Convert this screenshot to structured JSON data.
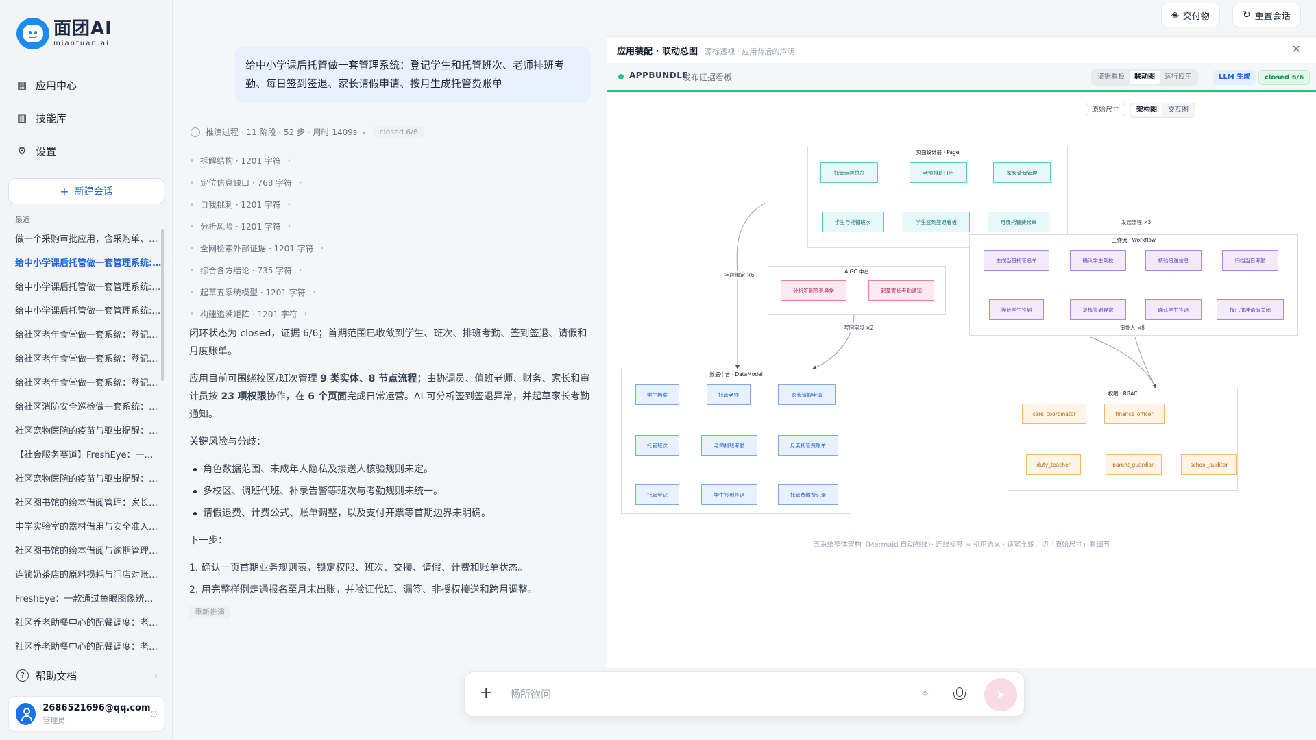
{
  "app": {
    "logo_main": "面团AI",
    "logo_sub": "miantuan.ai"
  },
  "nav": {
    "apps": "应用中心",
    "skills": "技能库",
    "settings": "设置"
  },
  "new_chat": "新建会话",
  "recent_label": "最近",
  "history": [
    "做一个采购审批应用，含采购单、经…",
    "给中小学课后托管做一套管理系统: …",
    "给中小学课后托管做一套管理系统: …",
    "给中小学课后托管做一套管理系统: …",
    "给社区老年食堂做一套系统：登记就…",
    "给社区老年食堂做一套系统：登记就…",
    "给社区老年食堂做一套系统：登记就…",
    "给社区消防安全巡检做一套系统：登…",
    "社区宠物医院的疫苗与驱虫提醒：建…",
    "【社会服务赛道】FreshEye：一款通…",
    "社区宠物医院的疫苗与驱虫提醒：建…",
    "社区图书馆的绘本借阅管理：家长预…",
    "中学实验室的器材借用与安全准入：…",
    "社区图书馆的绘本借阅与逾期管理：…",
    "连锁奶茶店的原料损耗与门店对账：…",
    "FreshEye：一款通过鱼眼图像辨别水…",
    "社区养老助餐中心的配餐调度：老人…",
    "社区养老助餐中心的配餐调度：老人…"
  ],
  "help": "帮助文档",
  "user": {
    "email": "2686521696@qq.com",
    "role": "管理员"
  },
  "top_buttons": {
    "deliverables": "交付物",
    "reset": "重置会话"
  },
  "chat": {
    "prompt": "给中小学课后托管做一套管理系统：登记学生和托管班次、老师排班考勤、每日签到签退、家长请假申请、按月生成托管费账单",
    "reason_summary": "推演过程 · 11 阶段 · 52 步 · 用时 1409s",
    "reason_badge": "closed 6/6",
    "steps": [
      "拆解结构 · 1201 字符",
      "定位信息缺口 · 768 字符",
      "自我挑刺 · 1201 字符",
      "分析风险 · 1201 字符",
      "全网检索外部证据 · 1201 字符",
      "综合各方结论 · 735 字符",
      "起草五系统模型 · 1201 字符",
      "构建追溯矩阵 · 1201 字符"
    ],
    "answer_p1": "闭环状态为 closed，证据 6/6；首期范围已收敛到学生、班次、排班考勤、签到签退、请假和月度账单。",
    "answer_p2a": "应用目前可围绕校区/班次管理 ",
    "answer_p2b": "9 类实体、8 节点流程",
    "answer_p2c": "；由协调员、值班老师、财务、家长和审计员按 ",
    "answer_p2d": "23 项权限",
    "answer_p2e": "协作，在 ",
    "answer_p2f": "6 个页面",
    "answer_p2g": "完成日常运营。AI 可分析签到签退异常，并起草家长考勤通知。",
    "risk_title": "关键风险与分歧：",
    "risks": [
      "角色数据范围、未成年人隐私及接送人核验规则未定。",
      "多校区、调班代班、补录告警等班次与考勤规则未统一。",
      "请假退费、计费公式、账单调整，以及支付开票等首期边界未明确。"
    ],
    "next_title": "下一步：",
    "next_steps": [
      "1. 确认一页首期业务规则表，锁定权限、班次、交接、请假、计费和账单状态。",
      "2. 用完整样例走通报名至月末出账，并验证代班、漏签、非授权接送和跨月调整。"
    ],
    "redo": "重新推演"
  },
  "panel": {
    "title": "应用装配 · 联动总图",
    "subtitle": "源标透视 · 应用背后的声明",
    "bundle": "APPBUNDLE",
    "bundle_sub": "发布证据看板",
    "tabs": [
      "证据看板",
      "联动图",
      "运行应用"
    ],
    "llm": "LLM 生成",
    "closed": "closed 6/6",
    "view_original": "原始尺寸",
    "views": [
      "架构图",
      "交互图"
    ],
    "caption": "五系统整体架构（Mermaid 自动布线）· 连线标签 = 引用语义 · 适宽全貌，切「原始尺寸」看细节"
  },
  "diagram": {
    "page": {
      "title": "页面设计器 · Page",
      "nodes": [
        "托管运营总览",
        "老师排班日历",
        "家长请假管理",
        "学生与托管班次",
        "学生签到签退看板",
        "月度托管费账单"
      ]
    },
    "workflow": {
      "title": "工作流 · Workflow",
      "nodes": [
        "生成当日托管名单",
        "确认学生到校",
        "核验接送信息",
        "归档当日考勤",
        "等待学生签到",
        "复核签到异常",
        "确认学生签退",
        "按已批准请假关闭"
      ]
    },
    "aigc": {
      "title": "AIGC 中台",
      "nodes": [
        "分析签到签退异常",
        "起草家长考勤通知"
      ]
    },
    "datamodel": {
      "title": "数据中台 · DataModel",
      "nodes": [
        "学生档案",
        "托管老师",
        "家长请假申请",
        "托管班次",
        "老师排班考勤",
        "月度托管费账单",
        "托管登记",
        "学生签到签退",
        "托管费缴费记录"
      ]
    },
    "rbac": {
      "title": "权限 · RBAC",
      "nodes": [
        "care_coordinator",
        "finance_officer",
        "duty_teacher",
        "parent_guardian",
        "school_auditor"
      ]
    },
    "edges": {
      "start_flow": "发起流程 ×3",
      "field_bind": "字段绑定 ×6",
      "write_back": "写回字段 ×2",
      "approver": "审批人 ×8"
    }
  },
  "composer": {
    "placeholder": "畅所欲问"
  },
  "colors": {
    "accent": "#1f64d8",
    "success": "#22c67a",
    "brand": "#1a8cf0"
  }
}
